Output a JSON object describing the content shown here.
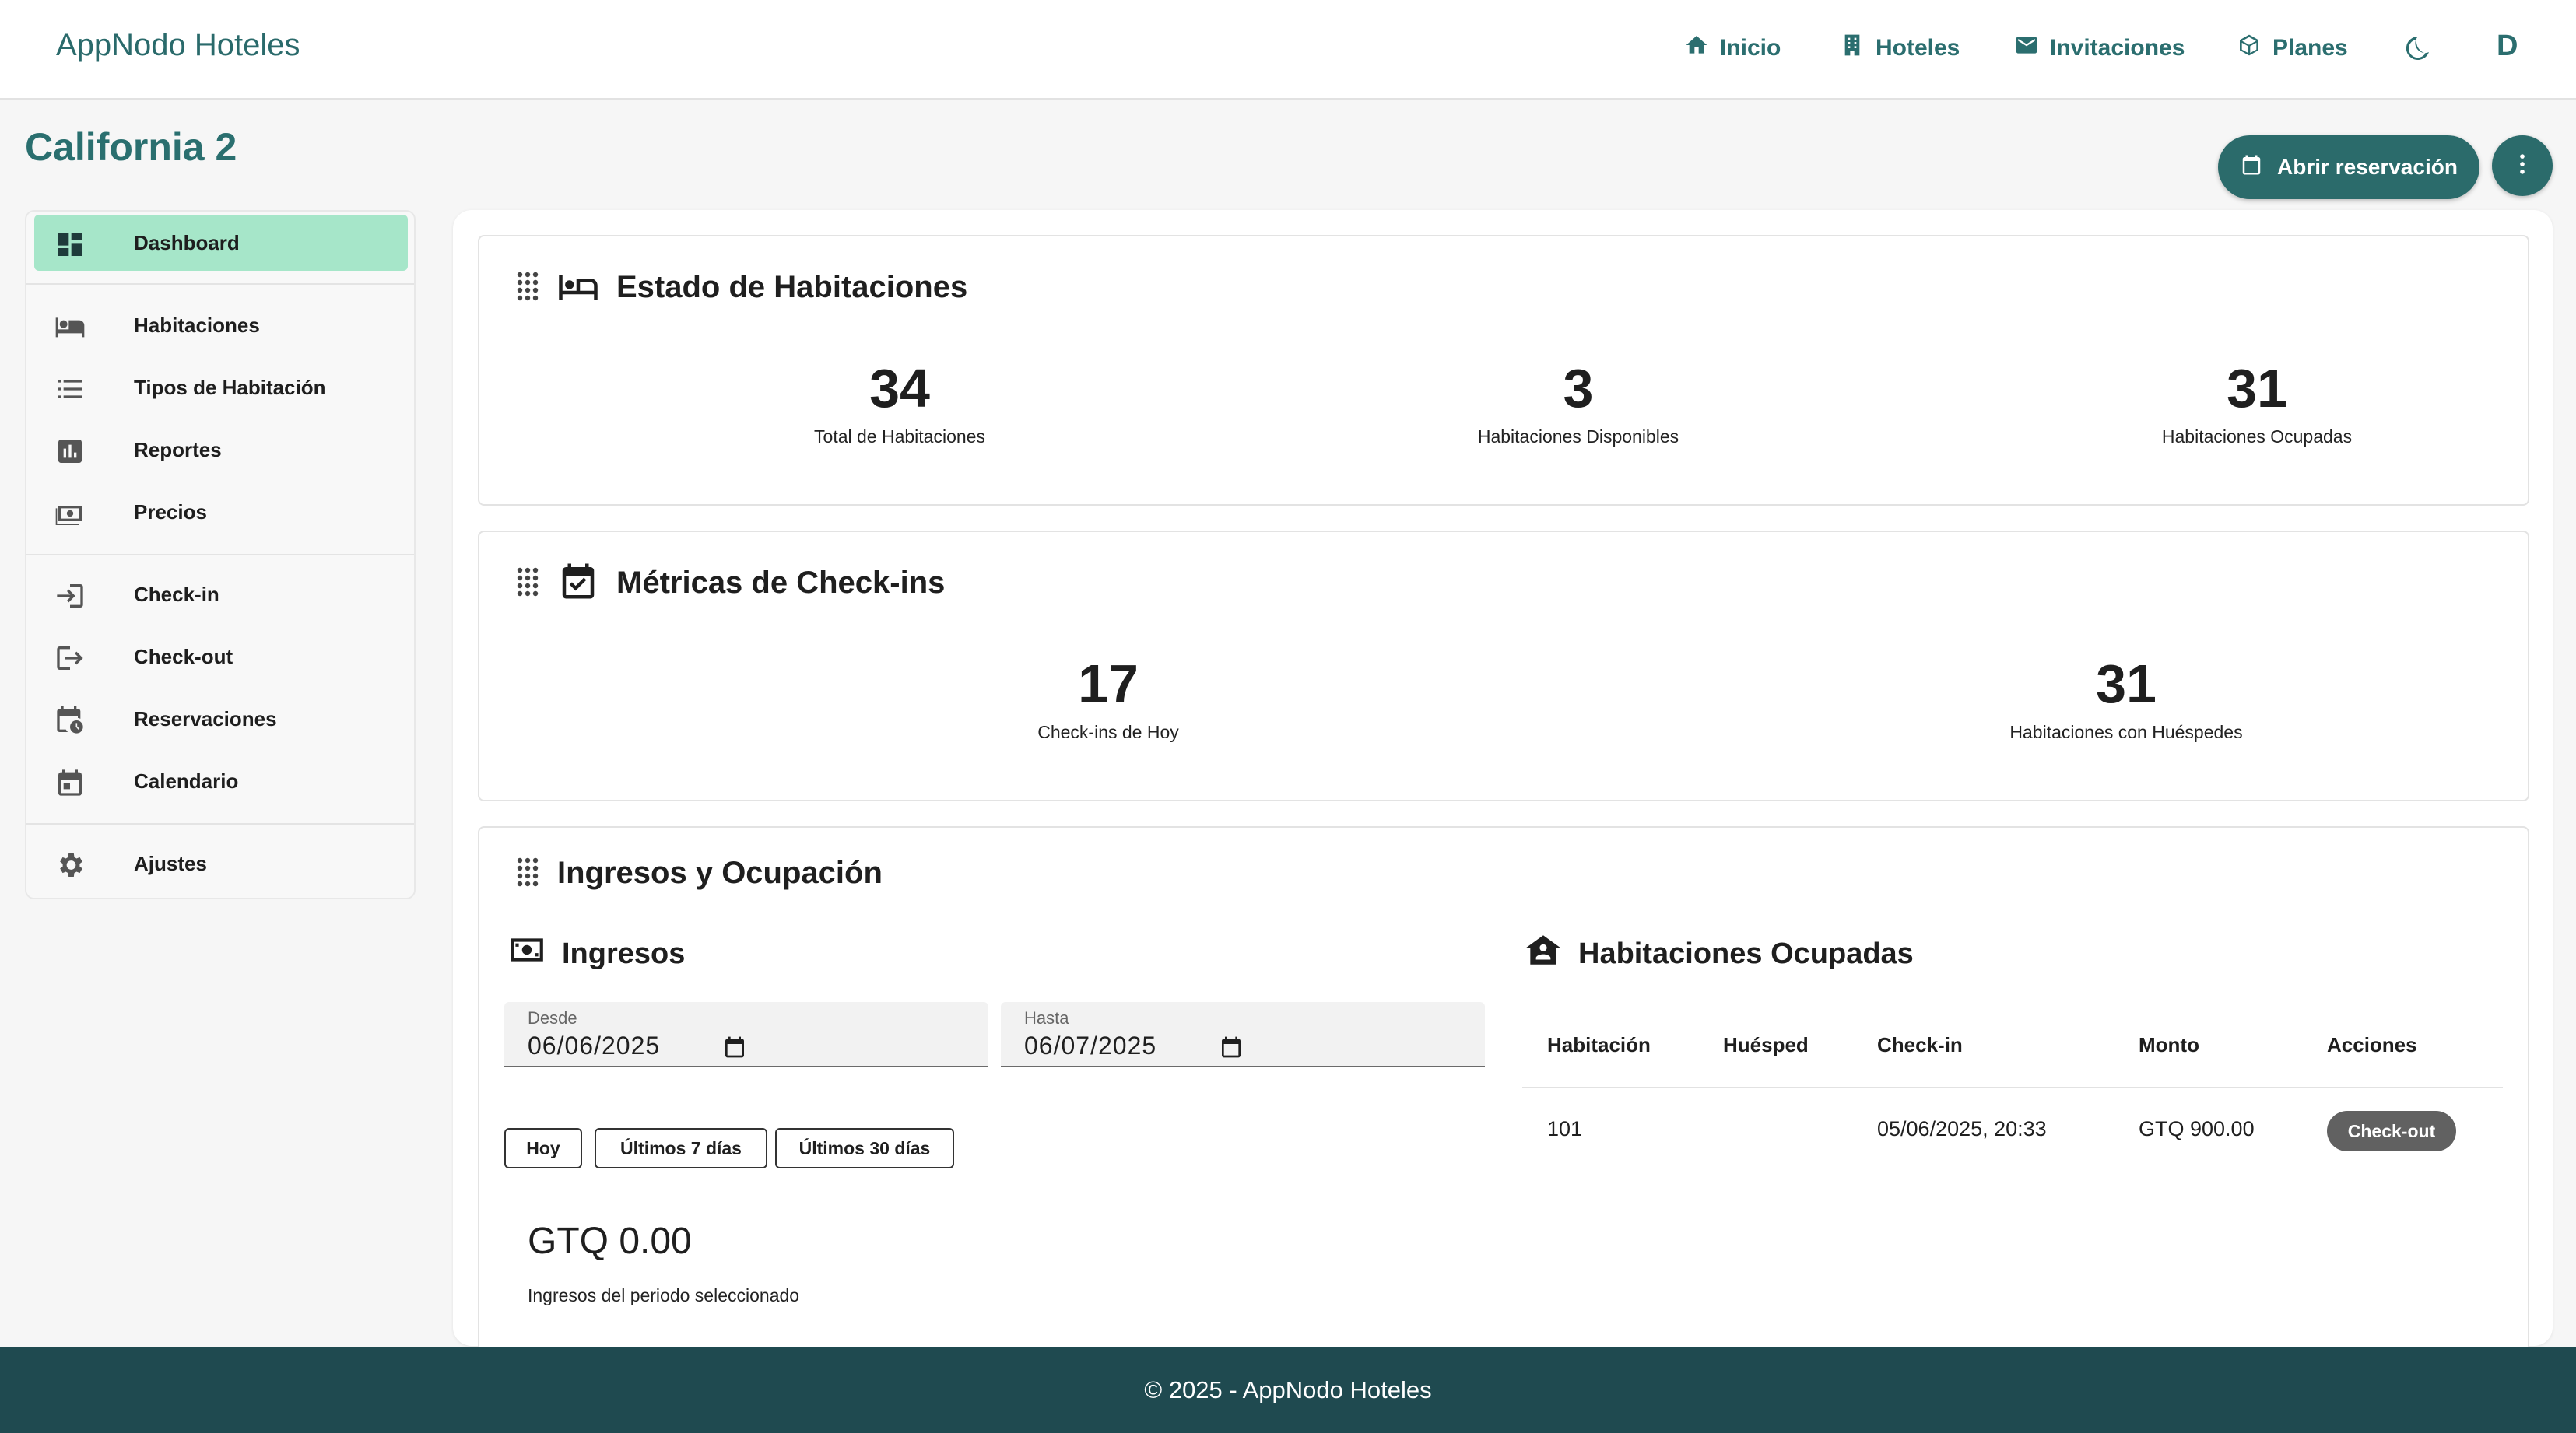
{
  "app": {
    "brand": "AppNodo Hoteles"
  },
  "nav": {
    "items": [
      {
        "label": "Inicio",
        "icon": "home-icon"
      },
      {
        "label": "Hoteles",
        "icon": "building-icon"
      },
      {
        "label": "Invitaciones",
        "icon": "mail-icon"
      },
      {
        "label": "Planes",
        "icon": "package-icon"
      }
    ],
    "theme_icon": "moon-icon",
    "avatar": "D"
  },
  "page": {
    "title": "California 2",
    "primary_action": "Abrir reservación",
    "more_icon": "more-vert-icon"
  },
  "sidebar": {
    "items": [
      {
        "label": "Dashboard",
        "icon": "dashboard-icon",
        "active": true
      },
      {
        "label": "Habitaciones",
        "icon": "bed-icon"
      },
      {
        "label": "Tipos de Habitación",
        "icon": "list-icon"
      },
      {
        "label": "Reportes",
        "icon": "bar-chart-icon"
      },
      {
        "label": "Precios",
        "icon": "money-icon"
      },
      {
        "label": "Check-in",
        "icon": "login-icon"
      },
      {
        "label": "Check-out",
        "icon": "logout-icon"
      },
      {
        "label": "Reservaciones",
        "icon": "calendar-clock-icon"
      },
      {
        "label": "Calendario",
        "icon": "calendar-icon"
      },
      {
        "label": "Ajustes",
        "icon": "gear-icon"
      }
    ]
  },
  "room_status": {
    "title": "Estado de Habitaciones",
    "stats": [
      {
        "value": "34",
        "label": "Total de Habitaciones"
      },
      {
        "value": "3",
        "label": "Habitaciones Disponibles"
      },
      {
        "value": "31",
        "label": "Habitaciones Ocupadas"
      }
    ]
  },
  "checkin_metrics": {
    "title": "Métricas de Check-ins",
    "stats": [
      {
        "value": "17",
        "label": "Check-ins de Hoy"
      },
      {
        "value": "31",
        "label": "Habitaciones con Huéspedes"
      }
    ]
  },
  "revenue": {
    "title": "Ingresos y Ocupación",
    "income_title": "Ingresos",
    "from_label": "Desde",
    "from_value": "06/06/2025",
    "to_label": "Hasta",
    "to_value": "06/07/2025",
    "quick_ranges": [
      "Hoy",
      "Últimos 7 días",
      "Últimos 30 días"
    ],
    "amount": "GTQ 0.00",
    "amount_caption": "Ingresos del periodo seleccionado"
  },
  "occupied": {
    "title": "Habitaciones Ocupadas",
    "columns": [
      "Habitación",
      "Huésped",
      "Check-in",
      "Monto",
      "Acciones"
    ],
    "rows": [
      {
        "room": "101",
        "guest": "",
        "checkin": "05/06/2025, 20:33",
        "amount": "GTQ 900.00",
        "action": "Check-out"
      }
    ]
  },
  "footer": {
    "text": "© 2025 - AppNodo Hoteles"
  }
}
